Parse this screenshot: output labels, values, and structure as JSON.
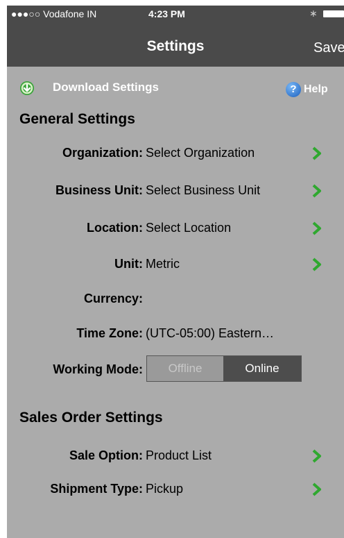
{
  "status": {
    "carrier": "●●●○○ Vodafone IN",
    "time": "4:23 PM",
    "bluetooth": "∗"
  },
  "nav": {
    "title": "Settings",
    "save_label": "Save"
  },
  "toolbar": {
    "download_label": "Download Settings",
    "help_label": "Help",
    "help_glyph": "?"
  },
  "general": {
    "title": "General Settings",
    "rows": [
      {
        "label": "Organization:",
        "value": "Select Organization"
      },
      {
        "label": "Business Unit:",
        "value": "Select Business Unit"
      },
      {
        "label": "Location:",
        "value": "Select Location"
      },
      {
        "label": "Unit:",
        "value": "Metric"
      },
      {
        "label": "Currency:",
        "value": ""
      },
      {
        "label": "Time Zone:",
        "value": "(UTC-05:00) Eastern…"
      }
    ],
    "working_mode": {
      "label": "Working Mode:",
      "options": [
        "Offline",
        "Online"
      ],
      "selected": "Online"
    }
  },
  "sales": {
    "title": "Sales Order Settings",
    "rows": [
      {
        "label": "Sale Option:",
        "value": "Product List"
      },
      {
        "label": "Shipment Type:",
        "value": "Pickup"
      }
    ]
  },
  "colors": {
    "bar": "#4a4a4a",
    "background": "#ababab",
    "chevron": "#2fa82f",
    "help": "#1a5fbf"
  }
}
